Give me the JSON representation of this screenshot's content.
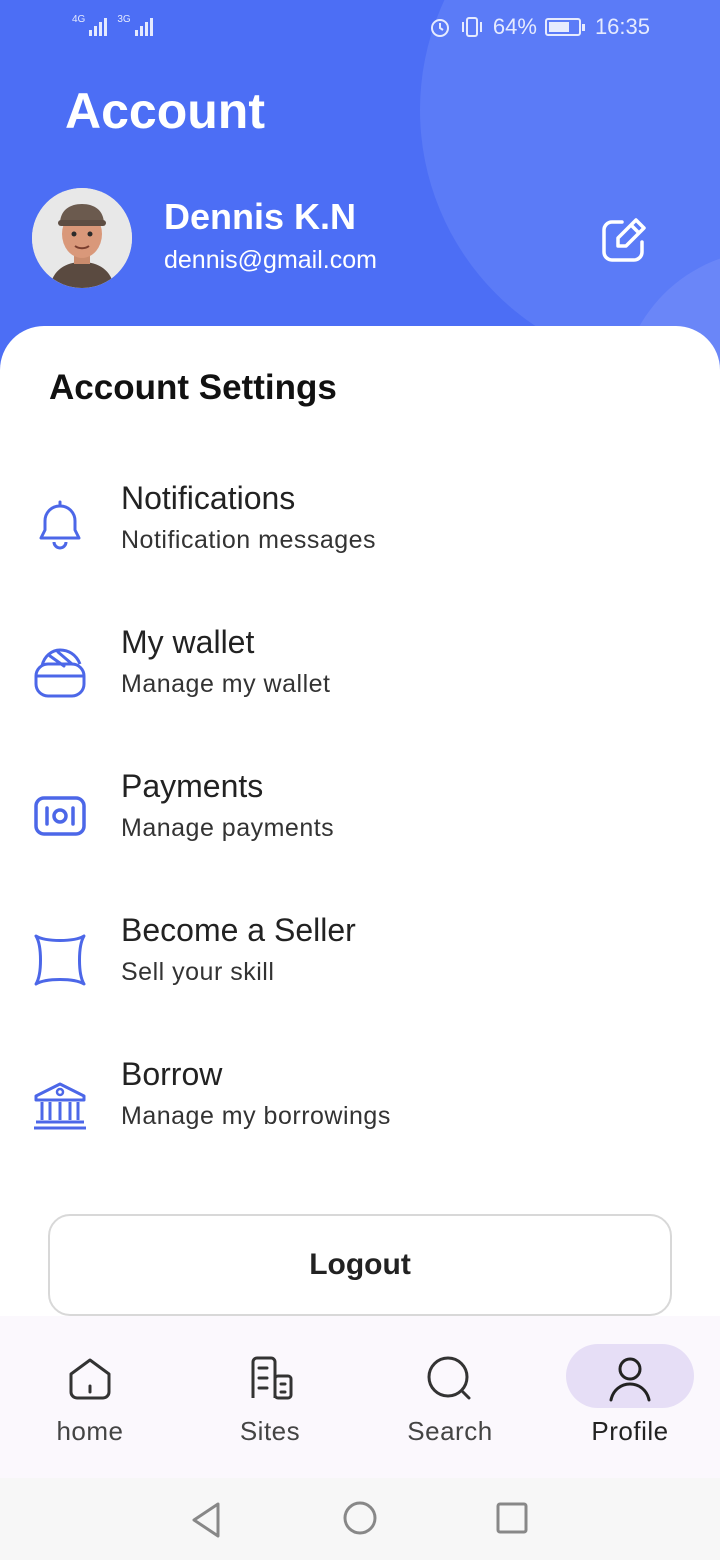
{
  "status_bar": {
    "network1": "4G",
    "network2": "3G",
    "battery_percent": "64%",
    "time": "16:35"
  },
  "header": {
    "title": "Account",
    "user_name": "Dennis K.N",
    "user_email": "dennis@gmail.com"
  },
  "settings": {
    "section_title": "Account Settings",
    "items": [
      {
        "title": "Notifications",
        "subtitle": "Notification messages",
        "icon": "bell-icon"
      },
      {
        "title": "My wallet",
        "subtitle": "Manage my wallet",
        "icon": "wallet-icon"
      },
      {
        "title": "Payments",
        "subtitle": "Manage payments",
        "icon": "money-icon"
      },
      {
        "title": "Become a Seller",
        "subtitle": "Sell your skill",
        "icon": "shape-icon"
      },
      {
        "title": "Borrow",
        "subtitle": "Manage my borrowings",
        "icon": "bank-icon"
      }
    ]
  },
  "logout_label": "Logout",
  "bottom_nav": [
    {
      "label": "home",
      "icon": "home-icon",
      "active": false
    },
    {
      "label": "Sites",
      "icon": "buildings-icon",
      "active": false
    },
    {
      "label": "Search",
      "icon": "search-icon",
      "active": false
    },
    {
      "label": "Profile",
      "icon": "profile-icon",
      "active": true
    }
  ],
  "colors": {
    "primary": "#4c6ef5",
    "icon_blue": "#4c67e8",
    "active_pill": "#e6def6"
  }
}
